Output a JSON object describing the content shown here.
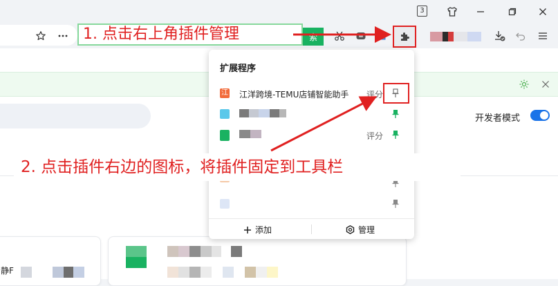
{
  "titlebar": {
    "tab_count": "3"
  },
  "toolbar": {
    "green_chip_label": "索"
  },
  "annotations": {
    "step1": "1. 点击右上角插件管理",
    "step2": "2. 点击插件右边的图标，将插件固定到工具栏"
  },
  "popup": {
    "title": "扩展程序",
    "extensions": [
      {
        "icon_text": "江",
        "icon_color": "#f26b3a",
        "name": "江洋跨境-TEMU店铺智能助手",
        "score": "评分",
        "pinned": false
      },
      {
        "icon_text": "",
        "icon_color": "#5bc8ea",
        "name": "",
        "score": "",
        "pinned": true
      },
      {
        "icon_text": "",
        "icon_color": "#19b261",
        "name": "",
        "score": "评分",
        "pinned": true
      },
      {
        "icon_text": "",
        "icon_color": "#f5c8a6",
        "name": "",
        "score": "",
        "pinned": false
      },
      {
        "icon_text": "",
        "icon_color": "#dde6f6",
        "name": "",
        "score": "",
        "pinned": false
      }
    ],
    "add_label": "添加",
    "manage_label": "管理"
  },
  "page": {
    "dev_mode_label": "开发者模式",
    "card_left_fragment": "静F"
  },
  "colors": {
    "accent_red": "#e02020",
    "pin_green": "#19b261",
    "toggle_blue": "#1a73e8"
  }
}
